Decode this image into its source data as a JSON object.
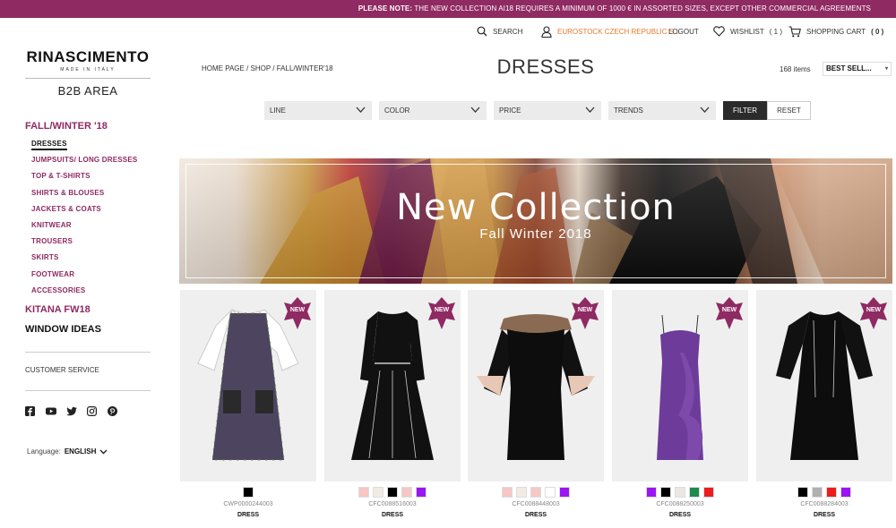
{
  "notice": {
    "prefix": "PLEASE NOTE:",
    "text": " THE NEW COLLECTION AI18 REQUIRES A MINIMUM OF 1000 € IN ASSORTED SIZES, EXCEPT OTHER COMMERCIAL AGREEMENTS"
  },
  "util": {
    "search": "SEARCH",
    "account": "EUROSTOCK CZECH REPUBLIC S...",
    "logout": "LOGOUT",
    "wishlist": "WISHLIST",
    "wishlist_count": "( 1 )",
    "cart": "SHOPPING CART",
    "cart_count": "( 0 )"
  },
  "logo": {
    "name": "RINASCIMENTO",
    "tag": "MADE IN ITALY",
    "area": "B2B AREA"
  },
  "sidebar": {
    "season": "FALL/WINTER '18",
    "items": [
      "DRESSES",
      "JUMPSUITS/ LONG DRESSES",
      "TOP & T-SHIRTS",
      "SHIRTS & BLOUSES",
      "JACKETS & COATS",
      "KNITWEAR",
      "TROUSERS",
      "SKIRTS",
      "FOOTWEAR",
      "ACCESSORIES"
    ],
    "kitana": "KITANA FW18",
    "window": "WINDOW IDEAS",
    "customer_service": "CUSTOMER SERVICE",
    "language_label": "Language:",
    "language_value": "ENGLISH"
  },
  "breadcrumb": "HOME PAGE  /  SHOP  /  FALL/WINTER'18",
  "page_title": "DRESSES",
  "item_count": "168 items",
  "sort_value": "BEST SELL...",
  "filters": [
    "LINE",
    "COLOR",
    "PRICE",
    "TRENDS"
  ],
  "filter_button": "FILTER",
  "reset_button": "RESET",
  "banner": {
    "title": "New Collection",
    "subtitle": "Fall Winter 2018"
  },
  "badge_label": "NEW",
  "products": [
    {
      "code": "CWP0000244003",
      "type": "DRESS",
      "swatches": [
        "#000000"
      ]
    },
    {
      "code": "CFC0088516003",
      "type": "DRESS",
      "swatches": [
        "#f6c7c4",
        "#f1ebe3",
        "#000000",
        "#f6c7c4",
        "#9b14f5"
      ]
    },
    {
      "code": "CFC0088448003",
      "type": "DRESS",
      "swatches": [
        "#f6c7c4",
        "#f1ebe3",
        "#f6c7c4",
        "#ffffff",
        "#9b14f5"
      ]
    },
    {
      "code": "CFC0088250003",
      "type": "DRESS",
      "swatches": [
        "#9b14f5",
        "#000000",
        "#ece8e0",
        "#1f8a4c",
        "#ee1c1c"
      ]
    },
    {
      "code": "CFC0088284003",
      "type": "DRESS",
      "swatches": [
        "#000000",
        "#b0b0b0",
        "#ee1c1c",
        "#9b14f5"
      ]
    }
  ],
  "colors": {
    "brand": "#8f2a62",
    "accent_orange": "#e8792b"
  }
}
